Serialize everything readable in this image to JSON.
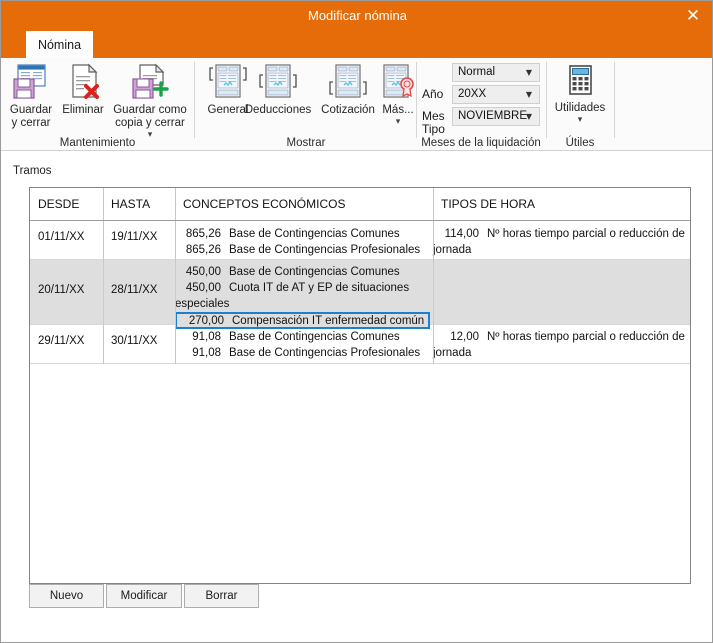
{
  "window": {
    "title": "Modificar nómina",
    "close_label": "✕"
  },
  "ribbon": {
    "tab_label": "Nómina",
    "groups": [
      {
        "name": "Mantenimiento",
        "label": "Mantenimiento"
      },
      {
        "name": "Mostrar",
        "label": "Mostrar"
      },
      {
        "name": "Meses de la liquidación",
        "label": "Meses de la liquidación"
      },
      {
        "name": "Útiles",
        "label": "Útiles"
      }
    ],
    "maintenance": {
      "save_close": "Guardar\ny cerrar",
      "save_close_l1": "Guardar",
      "save_close_l2": "y cerrar",
      "delete": "Eliminar",
      "save_copy_l1": "Guardar como",
      "save_copy_l2": "copia y cerrar",
      "save_copy_caret": "▾"
    },
    "show": {
      "general": "General",
      "deductions": "Deducciones",
      "contribution": "Cotización",
      "more": "Más...",
      "more_caret": "▾"
    },
    "period": {
      "type_label": "Tipo",
      "type_value": "Normal",
      "year_label": "Año",
      "year_value": "20XX",
      "month_label": "Mes",
      "month_value": "NOVIEMBRE",
      "arrow": "▼"
    },
    "tools": {
      "utilities": "Utilidades",
      "utilities_caret": "▾"
    }
  },
  "content": {
    "section_label": "Tramos",
    "table": {
      "columns": [
        "DESDE",
        "HASTA",
        "CONCEPTOS ECONÓMICOS",
        "TIPOS DE HORA"
      ],
      "rows": [
        {
          "desde": "01/11/XX",
          "hasta": "19/11/XX",
          "conceptos": [
            {
              "amount": "865,26",
              "desc": "Base de Contingencias Comunes",
              "selected": false
            },
            {
              "amount": "865,26",
              "desc": "Base de Contingencias Profesionales",
              "selected": false
            }
          ],
          "horas": [
            {
              "amount": "114,00",
              "desc": "Nº horas tiempo parcial o reducción de jornada"
            }
          ],
          "highlighted": false
        },
        {
          "desde": "20/11/XX",
          "hasta": "28/11/XX",
          "conceptos": [
            {
              "amount": "450,00",
              "desc": "Base de Contingencias Comunes",
              "selected": false
            },
            {
              "amount": "450,00",
              "desc": "Cuota IT de AT y EP de situaciones especiales",
              "selected": false
            },
            {
              "amount": "270,00",
              "desc": "Compensación IT enfermedad común",
              "selected": true
            }
          ],
          "horas": [],
          "highlighted": true
        },
        {
          "desde": "29/11/XX",
          "hasta": "30/11/XX",
          "conceptos": [
            {
              "amount": "91,08",
              "desc": "Base de Contingencias Comunes",
              "selected": false
            },
            {
              "amount": "91,08",
              "desc": "Base de Contingencias Profesionales",
              "selected": false
            }
          ],
          "horas": [
            {
              "amount": "12,00",
              "desc": "Nº horas tiempo parcial o reducción de jornada"
            }
          ],
          "highlighted": false
        }
      ]
    },
    "buttons": {
      "new": "Nuevo",
      "modify": "Modificar",
      "delete": "Borrar"
    }
  },
  "colors": {
    "title_bar": "#e56c09",
    "selection_border": "#1d7fd0",
    "alt_row": "#dedede"
  }
}
